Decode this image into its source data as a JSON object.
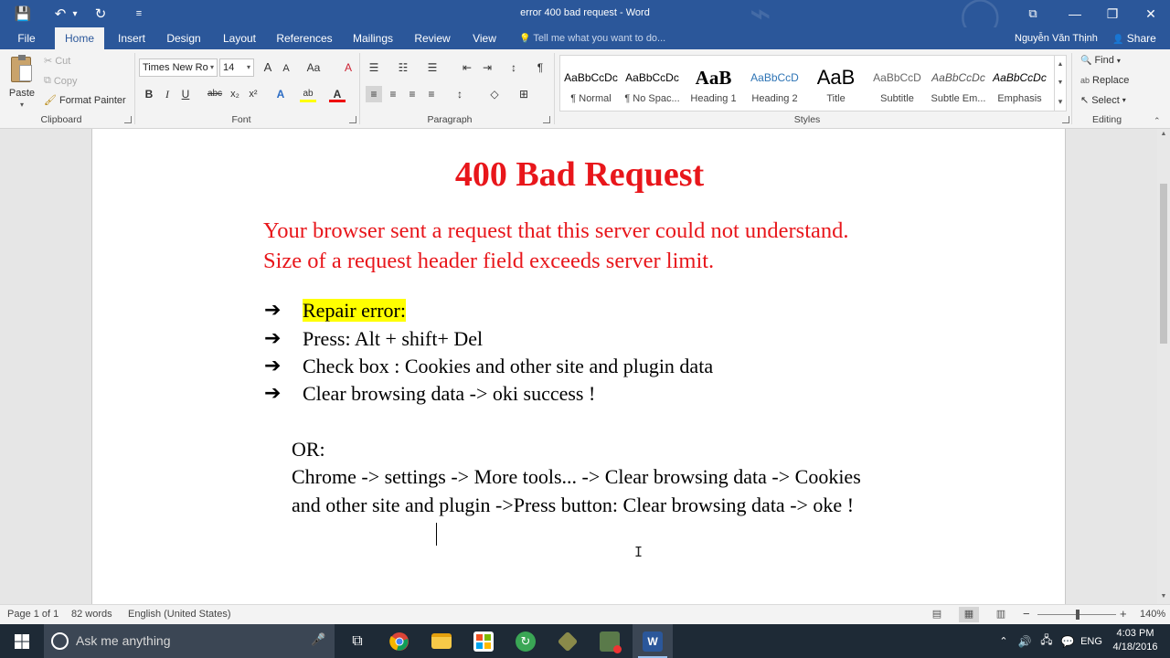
{
  "window": {
    "title": "error 400 bad request - Word",
    "controls": {
      "ribbon_display": "⧉",
      "minimize": "—",
      "restore": "❐",
      "close": "✕"
    }
  },
  "quick_access": {
    "save": "💾",
    "undo": "↶",
    "undo_menu": "▾",
    "redo": "↻",
    "customize": "≡"
  },
  "tabs": [
    "File",
    "Home",
    "Insert",
    "Design",
    "Layout",
    "References",
    "Mailings",
    "Review",
    "View"
  ],
  "active_tab": "Home",
  "tell_me": "Tell me what you want to do...",
  "tell_me_icon": "💡",
  "user": "Nguyễn Văn Thịnh",
  "share": "Share",
  "share_icon": "👤",
  "ribbon": {
    "clipboard": {
      "label": "Clipboard",
      "paste": "Paste",
      "paste_arrow": "▾",
      "cut": "Cut",
      "copy": "Copy",
      "format_painter": "Format Painter"
    },
    "font": {
      "label": "Font",
      "family": "Times New Ro",
      "size": "14",
      "grow": "A",
      "shrink": "A",
      "case": "Aa",
      "clear": "A",
      "bold": "B",
      "italic": "I",
      "underline": "U",
      "strike": "abc",
      "subscript": "x₂",
      "superscript": "x²",
      "effects": "A",
      "highlight": "ab",
      "font_color": "A"
    },
    "paragraph": {
      "label": "Paragraph",
      "bullets": "☰",
      "numbering": "☷",
      "multilevel": "☰",
      "decrease_indent": "⇤",
      "increase_indent": "⇥",
      "sort": "↕",
      "show_marks": "¶",
      "align_left": "≡",
      "center": "≡",
      "align_right": "≡",
      "justify": "≡",
      "spacing": "↕",
      "shading": "◇",
      "borders": "⊞"
    },
    "styles": {
      "label": "Styles",
      "items": [
        {
          "preview": "AaBbCcDc",
          "name": "¶ Normal"
        },
        {
          "preview": "AaBbCcDc",
          "name": "¶ No Spac..."
        },
        {
          "preview": "AaB",
          "name": "Heading 1"
        },
        {
          "preview": "AaBbCcD",
          "name": "Heading 2"
        },
        {
          "preview": "AaB",
          "name": "Title"
        },
        {
          "preview": "AaBbCcD",
          "name": "Subtitle"
        },
        {
          "preview": "AaBbCcDc",
          "name": "Subtle Em..."
        },
        {
          "preview": "AaBbCcDc",
          "name": "Emphasis"
        }
      ],
      "scroll": [
        "▲",
        "▼",
        "▾"
      ]
    },
    "editing": {
      "label": "Editing",
      "find": "Find",
      "replace": "Replace",
      "select": "Select",
      "find_icon": "🔍",
      "replace_icon": "ab",
      "select_icon": "↖"
    }
  },
  "document": {
    "heading": "400 Bad Request",
    "red_lines": [
      "Your browser sent a request that this server could not understand.",
      "Size of a request header field exceeds server limit."
    ],
    "bullet_symbol": "➔",
    "bullets": [
      "Repair error:",
      "Press: Alt + shift+ Del",
      "Check box : Cookies and other site and plugin data",
      "Clear browsing data -> oki success !"
    ],
    "or_label": "OR:",
    "paragraph_lines": [
      "Chrome -> settings -> More tools... -> Clear browsing data -> Cookies",
      "and other site and plugin ->Press button: Clear browsing data -> oke !"
    ],
    "highlight_color": "#ffff00",
    "accent_red": "#e8161b"
  },
  "statusbar": {
    "page": "Page 1 of 1",
    "words": "82 words",
    "language": "English (United States)",
    "zoom_minus": "−",
    "zoom_plus": "+",
    "zoom": "140%",
    "zoom_fraction": 0.49
  },
  "taskbar": {
    "search_placeholder": "Ask me anything",
    "mic": "🎤",
    "task_view": "⧉",
    "tray": {
      "chevron": "⌃",
      "volume": "🔊",
      "network": "🖧",
      "notifications": "💬"
    },
    "lang": "ENG",
    "time": "4:03 PM",
    "date": "4/18/2016"
  },
  "colors": {
    "word_blue": "#2b579a",
    "ribbon_bg": "#f3f3f3",
    "taskbar": "#1e2a36"
  }
}
